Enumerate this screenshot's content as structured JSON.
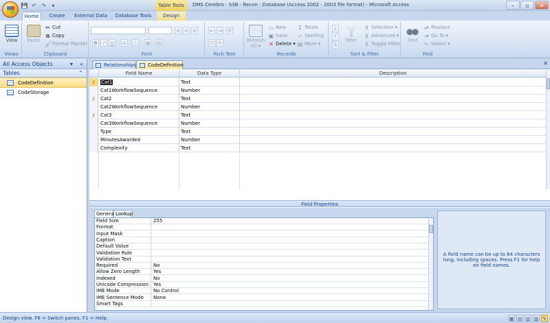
{
  "window": {
    "contextual_group": "Table Tools",
    "title": "DMS Cerebro - SSB - Recon : Database (Access 2002 - 2003 file format) - Microsoft Access",
    "qat": [
      "save-icon",
      "undo-icon",
      "redo-icon",
      "dropdown-icon"
    ],
    "controls": [
      "–",
      "▫",
      "✕"
    ]
  },
  "ribbon_tabs": [
    {
      "label": "Home",
      "active": true
    },
    {
      "label": "Create"
    },
    {
      "label": "External Data"
    },
    {
      "label": "Database Tools"
    },
    {
      "label": "Design",
      "contextual": true
    }
  ],
  "ribbon": {
    "views": {
      "label": "Views",
      "view_button": "View"
    },
    "clipboard": {
      "label": "Clipboard",
      "paste": "Paste",
      "cut": "Cut",
      "copy": "Copy",
      "format_painter": "Format Painter"
    },
    "font": {
      "label": "Font"
    },
    "rich_text": {
      "label": "Rich Text"
    },
    "records": {
      "label": "Records",
      "refresh": "Refresh",
      "refresh_sub": "All ▾",
      "new": "New",
      "save": "Save",
      "delete": "Delete ▾",
      "totals": "Totals",
      "spelling": "Spelling",
      "more": "More ▾"
    },
    "sort_filter": {
      "label": "Sort & Filter",
      "filter": "Filter",
      "selection": "Selection ▾",
      "advanced": "Advanced ▾",
      "toggle_filter": "Toggle Filter"
    },
    "find": {
      "label": "Find",
      "find": "Find",
      "replace": "Replace",
      "goto": "Go To ▾",
      "select": "Select ▾"
    }
  },
  "nav_pane": {
    "header": "All Access Objects",
    "group": "Tables",
    "items": [
      {
        "label": "CodeDefinition",
        "selected": true
      },
      {
        "label": "CodeStorage",
        "selected": false
      }
    ]
  },
  "doc_tabs": [
    {
      "label": "Relationships",
      "active": false
    },
    {
      "label": "CodeDefinition",
      "active": true
    }
  ],
  "grid": {
    "headers": {
      "field_name": "Field Name",
      "data_type": "Data Type",
      "description": "Description"
    },
    "rows": [
      {
        "field": "Cat1",
        "type": "Text",
        "key": true,
        "current": true
      },
      {
        "field": "Cat1WorkflowSequence",
        "type": "Number"
      },
      {
        "field": "Cat2",
        "type": "Text",
        "key": true
      },
      {
        "field": "Cat2WorkflowSequence",
        "type": "Number"
      },
      {
        "field": "Cat3",
        "type": "Text",
        "key": true
      },
      {
        "field": "Cat3WorkflowSequence",
        "type": "Number"
      },
      {
        "field": "Type",
        "type": "Text"
      },
      {
        "field": "MinutesAwarded",
        "type": "Number"
      },
      {
        "field": "Complexity",
        "type": "Text"
      }
    ]
  },
  "field_properties": {
    "title": "Field Properties",
    "tabs": [
      "General",
      "Lookup"
    ],
    "rows": [
      {
        "name": "Field Size",
        "value": "255"
      },
      {
        "name": "Format",
        "value": ""
      },
      {
        "name": "Input Mask",
        "value": ""
      },
      {
        "name": "Caption",
        "value": ""
      },
      {
        "name": "Default Value",
        "value": ""
      },
      {
        "name": "Validation Rule",
        "value": ""
      },
      {
        "name": "Validation Text",
        "value": ""
      },
      {
        "name": "Required",
        "value": "No"
      },
      {
        "name": "Allow Zero Length",
        "value": "Yes"
      },
      {
        "name": "Indexed",
        "value": "No"
      },
      {
        "name": "Unicode Compression",
        "value": "Yes"
      },
      {
        "name": "IME Mode",
        "value": "No Control"
      },
      {
        "name": "IME Sentence Mode",
        "value": "None"
      },
      {
        "name": "Smart Tags",
        "value": ""
      }
    ],
    "help": "A field name can be up to 64 characters long, including spaces.  Press F1 for help on field names."
  },
  "status": {
    "text": "Design view.  F6 = Switch panes.  F1 = Help."
  },
  "colors": {
    "accent": "#15428b",
    "selection": "#fbdc82",
    "ribbon_bg": "#d5e2f3"
  }
}
